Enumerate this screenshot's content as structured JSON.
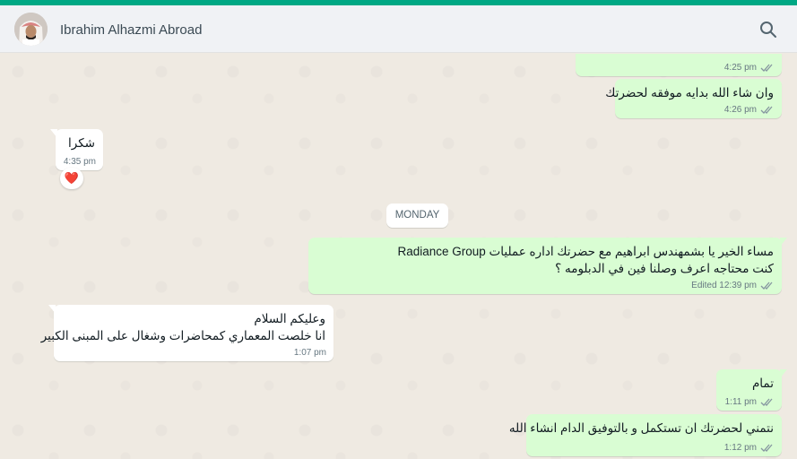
{
  "header": {
    "contact_name": "Ibrahim Alhazmi Abroad"
  },
  "colors": {
    "accent": "#00a884",
    "outgoing_bubble": "#d9fdd3",
    "incoming_bubble": "#ffffff",
    "chat_background": "#efeae2",
    "read_ticks": "#8696a0"
  },
  "messages": [
    {
      "direction": "outgoing",
      "text": "",
      "time": "4:25 pm",
      "status": "read"
    },
    {
      "direction": "outgoing",
      "text": "وان شاء الله بدايه موفقه لحضرتك",
      "time": "4:26 pm",
      "status": "read"
    },
    {
      "direction": "incoming",
      "text": "شكرا",
      "time": "4:35 pm",
      "reaction": "❤️"
    },
    {
      "direction": "outgoing",
      "lines": [
        "مساء  الخير يا بشمهندس ابراهيم  مع حضرتك اداره عمليات Radiance Group",
        "كنت محتاجه اعرف وصلنا فين في الدبلومه  ؟"
      ],
      "time": "Edited 12:39 pm",
      "status": "read"
    },
    {
      "direction": "incoming",
      "lines": [
        "وعليكم السلام",
        "انا خلصت المعماري كمحاضرات  وشغال على المبنى الكبير"
      ],
      "time": "1:07 pm"
    },
    {
      "direction": "outgoing",
      "text": "تمام",
      "time": "1:11 pm",
      "status": "read"
    },
    {
      "direction": "outgoing",
      "text": "نتمني لحضرتك ان تستكمل و بالتوفيق الدام انشاء الله",
      "time": "1:12 pm",
      "status": "read"
    }
  ],
  "day_divider": "MONDAY",
  "icons": {
    "search": "search-icon",
    "avatar": "avatar",
    "ticks": "double-check-icon",
    "reaction": "heart-icon"
  }
}
